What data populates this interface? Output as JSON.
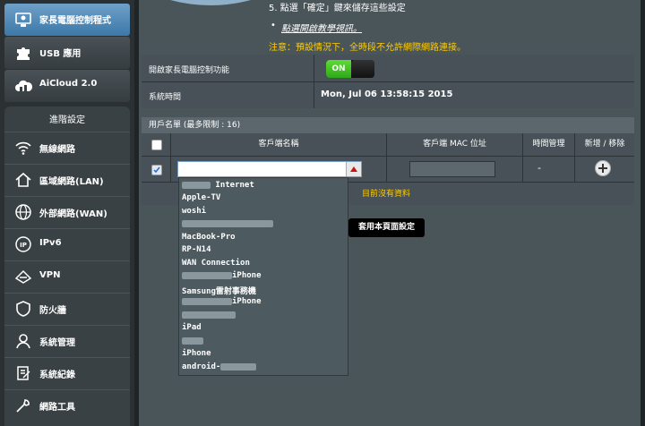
{
  "sidebar": {
    "top_items": [
      {
        "label": "家長電腦控制程式",
        "icon": "parental-control-icon"
      },
      {
        "label": "USB 應用",
        "icon": "puzzle-icon"
      },
      {
        "label": "AiCloud 2.0",
        "icon": "cloud-icon"
      }
    ],
    "advanced_header": "進階設定",
    "advanced_items": [
      {
        "label": "無線網路",
        "icon": "wifi-icon"
      },
      {
        "label": "區域網路(LAN)",
        "icon": "home-icon"
      },
      {
        "label": "外部網路(WAN)",
        "icon": "globe-icon"
      },
      {
        "label": "IPv6",
        "icon": "ipv6-icon"
      },
      {
        "label": "VPN",
        "icon": "vpn-icon"
      },
      {
        "label": "防火牆",
        "icon": "shield-icon"
      },
      {
        "label": "系統管理",
        "icon": "admin-icon"
      },
      {
        "label": "系統紀錄",
        "icon": "log-icon"
      },
      {
        "label": "網路工具",
        "icon": "tools-icon"
      }
    ]
  },
  "instructions": {
    "step5": "5. 點選「確定」鍵來儲存這些設定",
    "tutorial_link": "點選開啟教學視訊。",
    "note": "注意：預設情況下，全時段不允許網際網路連接。"
  },
  "settings": {
    "enable_label": "開啟家長電腦控制功能",
    "toggle_state": "ON",
    "system_time_label": "系統時間",
    "system_time_value": "Mon, Jul 06 13:58:15 2015"
  },
  "client_list": {
    "header": "用戶名單 (最多限制 : 16)",
    "columns": [
      "客戶端名稱",
      "客戶端 MAC 位址",
      "時間管理",
      "新增 / 移除"
    ],
    "time_placeholder": "-",
    "no_data": "目前沒有資料"
  },
  "apply_button": "套用本頁面設定",
  "dropdown_options": [
    {
      "label": "Internet",
      "prefix_blur": true
    },
    {
      "label": "Apple-TV"
    },
    {
      "label": "woshi"
    },
    {
      "label": "",
      "full_blur": true
    },
    {
      "label": "MacBook-Pro"
    },
    {
      "label": "RP-N14"
    },
    {
      "label": "WAN Connection"
    },
    {
      "label": "iPhone",
      "prefix_blur": true
    },
    {
      "label": "Samsung雷射事務機"
    },
    {
      "label": "iPhone",
      "prefix_blur": true
    },
    {
      "label": "",
      "full_blur": true
    },
    {
      "label": "iPad"
    },
    {
      "label": "",
      "full_blur": true
    },
    {
      "label": "iPhone"
    },
    {
      "label": "android-",
      "suffix_blur": true
    }
  ],
  "colors": {
    "accent": "#3c78a8",
    "warning": "#ffcc00",
    "toggle_on": "#3dbb22"
  }
}
